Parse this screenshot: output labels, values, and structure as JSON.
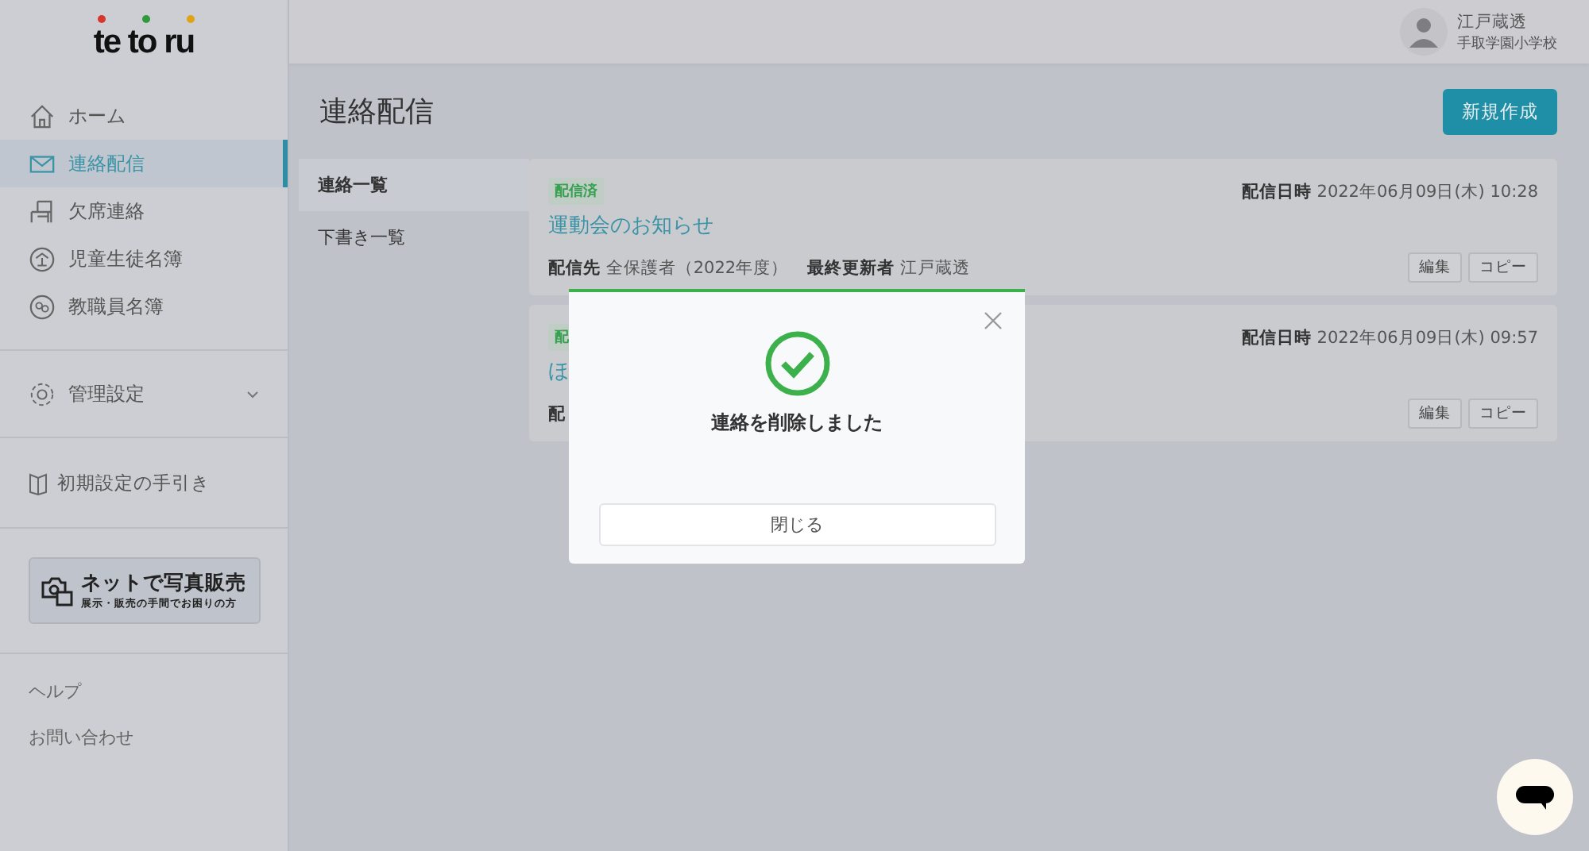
{
  "logo": {
    "text": "te to ru"
  },
  "sidebar": {
    "items": [
      {
        "label": "ホーム",
        "selected": false
      },
      {
        "label": "連絡配信",
        "selected": true
      },
      {
        "label": "欠席連絡",
        "selected": false
      },
      {
        "label": "児童生徒名簿",
        "selected": false
      },
      {
        "label": "教職員名簿",
        "selected": false
      }
    ],
    "settings": {
      "label": "管理設定",
      "expanded": false
    },
    "guide": "初期設定の手引き",
    "promo": {
      "title": "ネットで写真販売",
      "subtitle": "展示・販売の手間でお困りの方"
    },
    "links": [
      "ヘルプ",
      "お問い合わせ"
    ]
  },
  "user": {
    "name": "江戸蔵透",
    "school": "手取学園小学校"
  },
  "page_title": "連絡配信",
  "new_button": "新規作成",
  "subtabs": [
    {
      "label": "連絡一覧",
      "selected": true
    },
    {
      "label": "下書き一覧",
      "selected": false
    }
  ],
  "messages": [
    {
      "status": "配信済",
      "datetime_label": "配信日時",
      "datetime": "2022年06月09日(木) 10:28",
      "title": "運動会のお知らせ",
      "recipients_label": "配信先",
      "recipients": "全保護者（2022年度）",
      "updater_label": "最終更新者",
      "updater": "江戸蔵透",
      "actions": [
        "編集",
        "コピー"
      ]
    },
    {
      "status": "配",
      "datetime_label": "配信日時",
      "datetime": "2022年06月09日(木) 09:57",
      "title": "ほ",
      "recipients_label": "配",
      "actions": [
        "編集",
        "コピー"
      ]
    }
  ],
  "dialog": {
    "message": "連絡を削除しました",
    "close_button": "閉じる"
  }
}
